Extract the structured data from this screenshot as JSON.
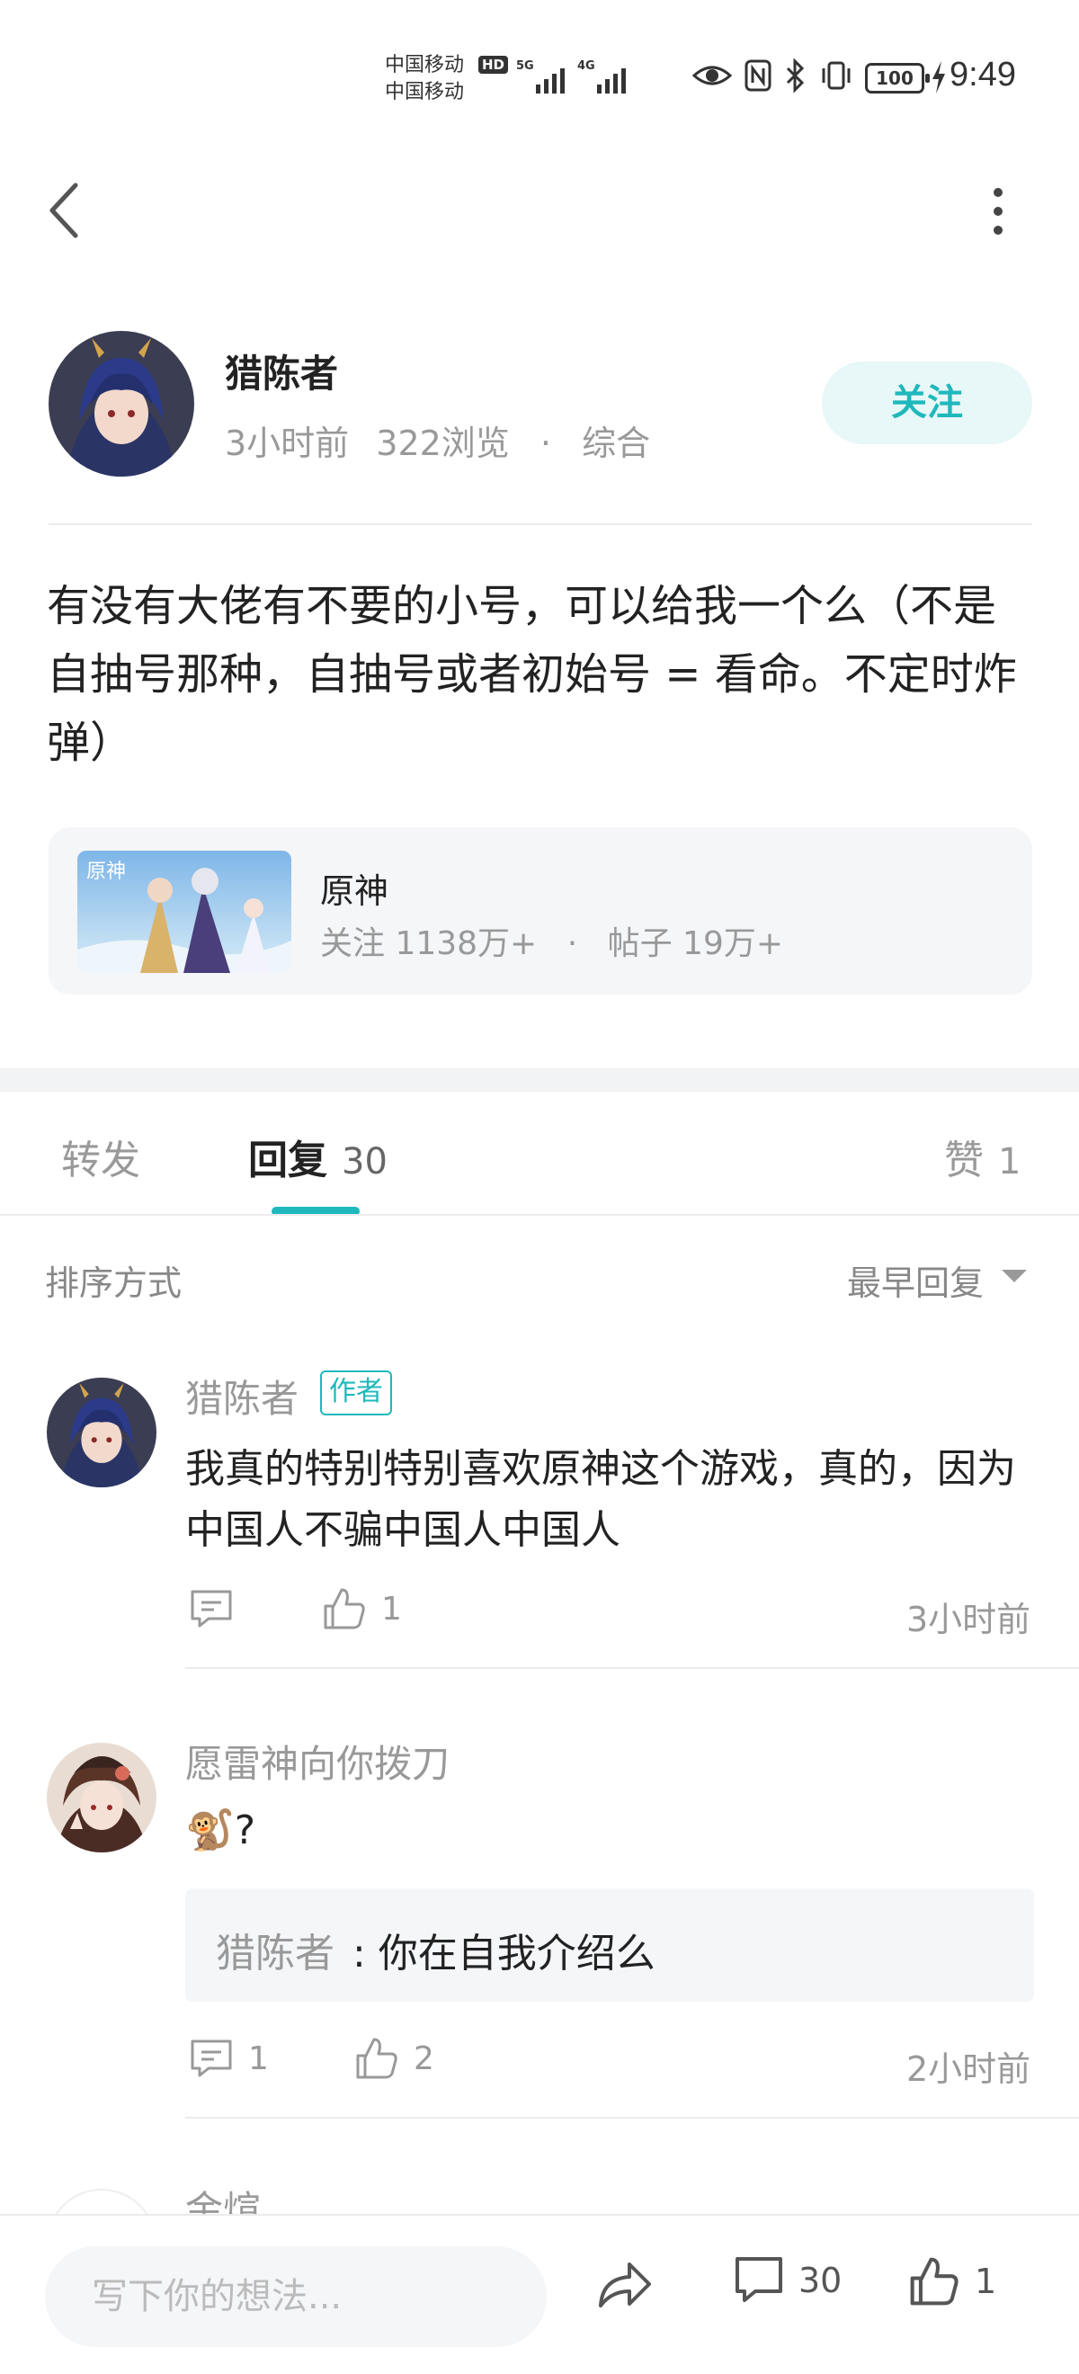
{
  "status_bar": {
    "carrier_1": "中国移动",
    "carrier_2": "中国移动",
    "hd": "HD",
    "net_1": "5G",
    "net_2": "4G",
    "battery": "100",
    "time": "9:49"
  },
  "post": {
    "author": {
      "name": "猎陈者",
      "time": "3小时前",
      "views": "322浏览",
      "category": "综合",
      "follow_label": "关注"
    },
    "content": "有没有大佬有不要的小号，可以给我一个么（不是自抽号那种，自抽号或者初始号 = 看命。不定时炸弹）",
    "forum": {
      "name": "原神",
      "followers": "关注 1138万+",
      "posts": "帖子 19万+"
    }
  },
  "tabs": {
    "repost": "转发",
    "reply": "回复",
    "reply_count": "30",
    "like": "赞",
    "like_count": "1"
  },
  "sort": {
    "label": "排序方式",
    "value": "最早回复"
  },
  "comments": [
    {
      "name": "猎陈者",
      "author_tag": "作者",
      "text": "我真的特别特别喜欢原神这个游戏，真的，因为中国人不骗中国人中国人",
      "reply_count": "",
      "like_count": "1",
      "time": "3小时前"
    },
    {
      "name": "愿雷神向你拨刀",
      "text": "🐒?",
      "quote_name": "猎陈者",
      "quote_text": ": 你在自我介绍么",
      "reply_count": "1",
      "like_count": "2",
      "time": "2小时前"
    },
    {
      "name": "金煊"
    }
  ],
  "bottom_bar": {
    "placeholder": "写下你的想法...",
    "comment_count": "30",
    "like_count": "1"
  },
  "colors": {
    "accent": "#1fb8bc",
    "accent_bg": "#e8f7f7",
    "muted_text": "#999999"
  }
}
